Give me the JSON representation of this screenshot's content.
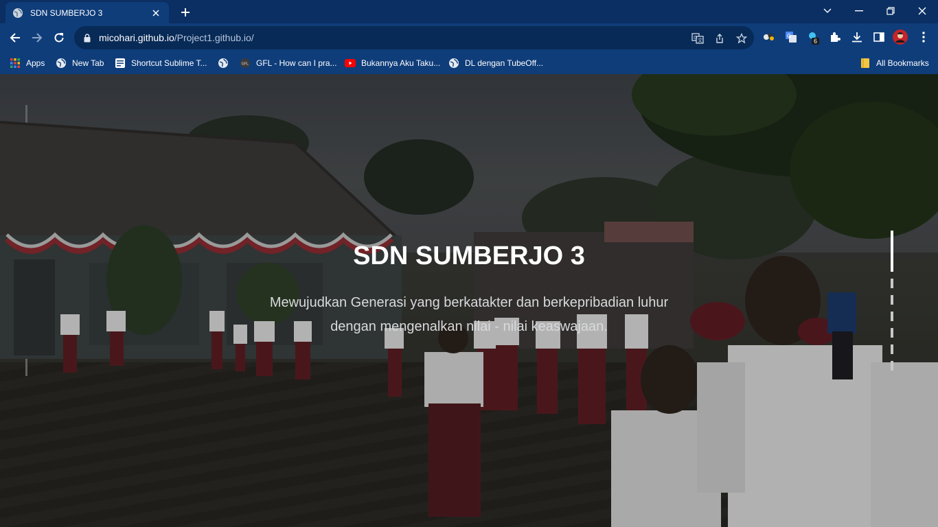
{
  "browser": {
    "tab": {
      "title": "SDN SUMBERJO 3"
    },
    "url": {
      "host": "micohari.github.io",
      "path": "/Project1.github.io/"
    },
    "extension_badge": "6",
    "bookmarks": [
      {
        "label": "Apps",
        "icon": "apps-grid-icon"
      },
      {
        "label": "New Tab",
        "icon": "globe-icon"
      },
      {
        "label": "Shortcut Sublime T...",
        "icon": "page-icon"
      },
      {
        "label": "",
        "icon": "globe-icon"
      },
      {
        "label": "GFL - How can I pra...",
        "icon": "gfl-icon"
      },
      {
        "label": "Bukannya Aku Taku...",
        "icon": "youtube-icon"
      },
      {
        "label": "DL dengan TubeOff...",
        "icon": "globe-icon"
      }
    ],
    "all_bookmarks_label": "All Bookmarks"
  },
  "hero": {
    "title": "SDN SUMBERJO 3",
    "subtitle_line1": "Mewujudkan Generasi yang berkatakter dan berkepribadian luhur",
    "subtitle_line2": "dengan mengenalkan nilai - nilai keaswajaan."
  },
  "slider": {
    "total_slides": 4,
    "active_index": 0
  },
  "colors": {
    "tab_strip": "#0b2f63",
    "toolbar": "#0f3d7a",
    "omnibox": "#082a57",
    "hero_title": "#ffffff"
  }
}
